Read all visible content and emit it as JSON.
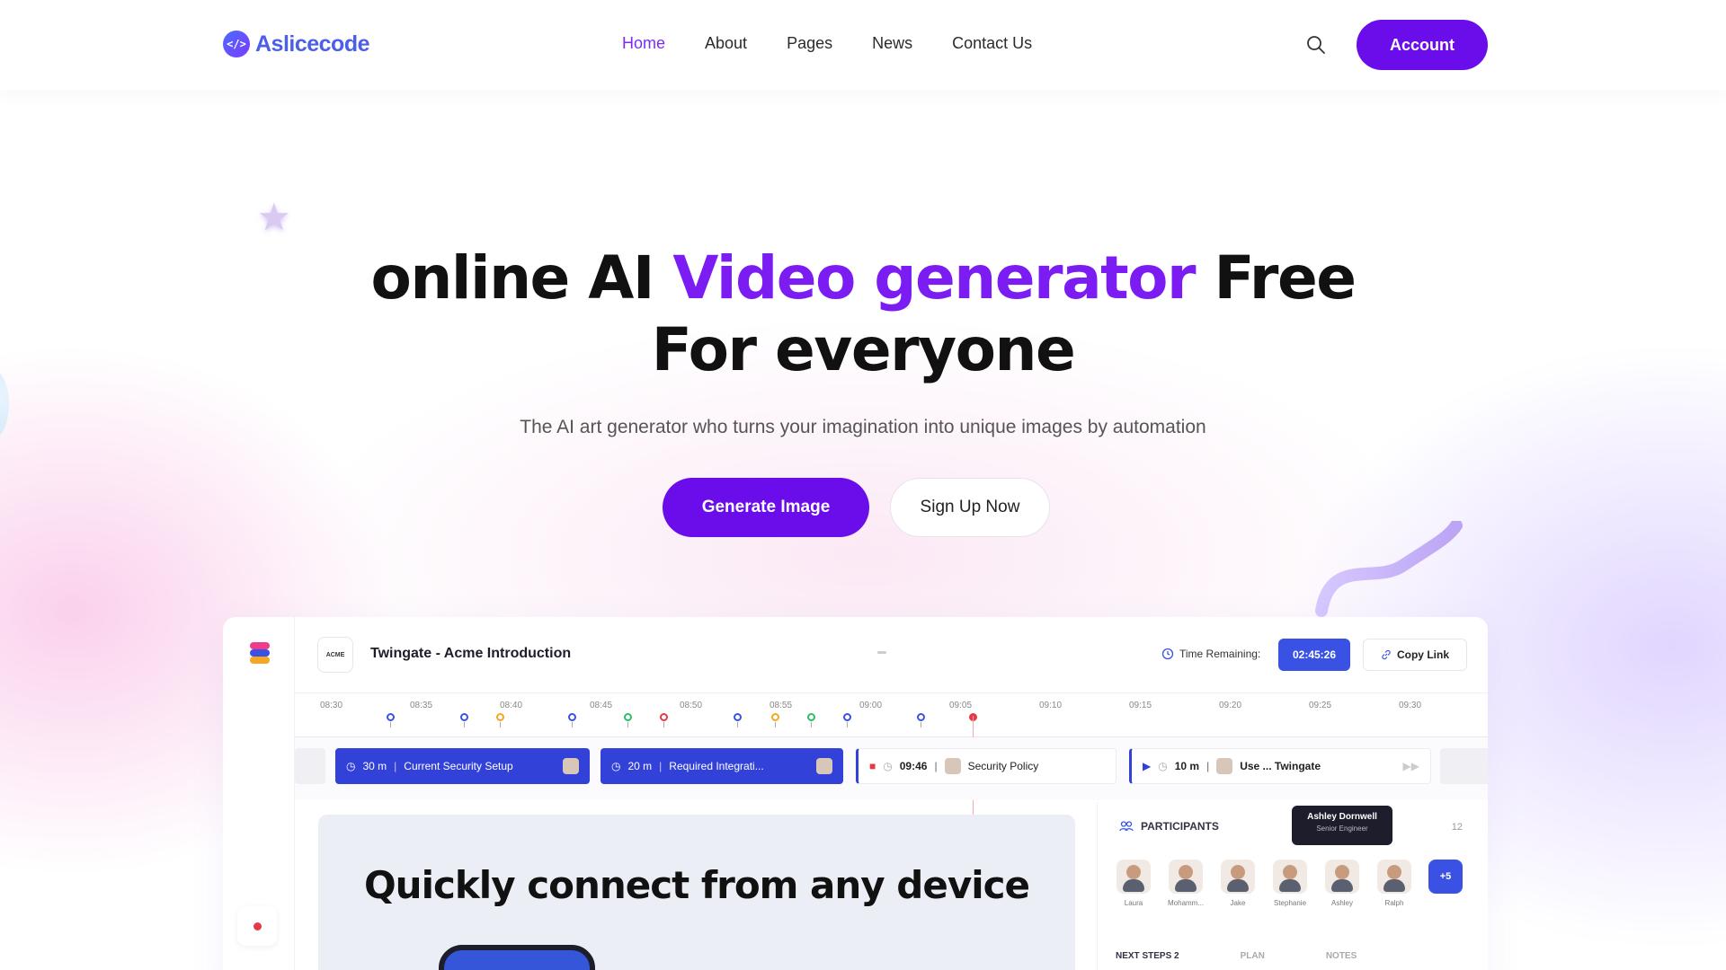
{
  "brand": {
    "name": "Aslicecode",
    "mark": "</>"
  },
  "nav": {
    "items": [
      {
        "label": "Home",
        "active": true
      },
      {
        "label": "About",
        "active": false
      },
      {
        "label": "Pages",
        "active": false
      },
      {
        "label": "News",
        "active": false
      },
      {
        "label": "Contact Us",
        "active": false
      }
    ],
    "account_label": "Account"
  },
  "hero": {
    "title_part1": "online AI ",
    "title_accent": "Video generator",
    "title_part2": " Free",
    "title_line2": "For everyone",
    "subtitle": "The AI art generator who turns your imagination into unique images by automation",
    "primary_cta": "Generate Image",
    "secondary_cta": "Sign Up Now"
  },
  "dashboard": {
    "company_badge": "ACME",
    "meeting_title": "Twingate - Acme Introduction",
    "time_remaining_label": "Time Remaining:",
    "time_remaining_value": "02:45:26",
    "copy_link_label": "Copy Link",
    "timeline_ticks": [
      "08:30",
      "08:35",
      "08:40",
      "08:45",
      "08:50",
      "08:55",
      "09:00",
      "09:05",
      "09:10",
      "09:15",
      "09:20",
      "09:25",
      "09:30"
    ],
    "segments": [
      {
        "duration": "30 m",
        "title": "Current Security Setup"
      },
      {
        "duration": "20 m",
        "title": "Required Integrati..."
      },
      {
        "duration": "09:46",
        "title": "Security Policy"
      },
      {
        "duration": "10 m",
        "title": "Use ... Twingate"
      }
    ],
    "content_heading": "Quickly connect from any device",
    "participants": {
      "title": "PARTICIPANTS",
      "count": "12",
      "tooltip_name": "Ashley Dornwell",
      "tooltip_role": "Senior Engineer",
      "people": [
        "Laura",
        "Mohamm...",
        "Jake",
        "Stephanie",
        "Ashley",
        "Ralph"
      ],
      "more_label": "+5"
    },
    "tabs": {
      "next_steps": "NEXT STEPS",
      "next_steps_count": "2",
      "plan": "PLAN",
      "notes": "NOTES"
    }
  },
  "colors": {
    "accent": "#7a1cf2",
    "button": "#6a0dea",
    "dashboard_blue": "#3242d8"
  }
}
